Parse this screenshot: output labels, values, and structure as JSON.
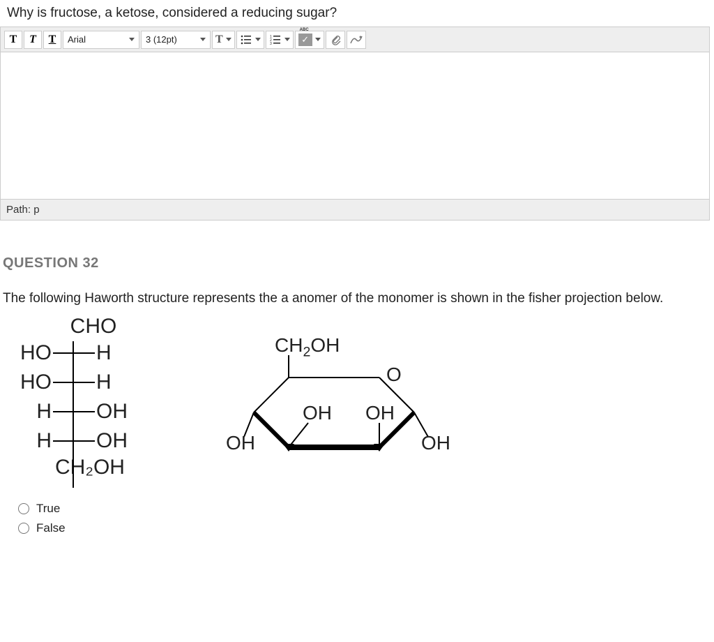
{
  "question1": {
    "prompt": "Why is fructose, a ketose, considered a reducing sugar?"
  },
  "toolbar": {
    "bold": "T",
    "italic": "T",
    "underline": "T",
    "font": "Arial",
    "size": "3 (12pt)",
    "textcolor": "T"
  },
  "path": {
    "label": "Path: p"
  },
  "question2": {
    "heading": "QUESTION 32",
    "text": "The following Haworth structure represents the a anomer of the monomer is shown in the fisher projection below."
  },
  "fischer": {
    "top": "CHO",
    "rows": [
      {
        "left": "HO",
        "right": "H"
      },
      {
        "left": "HO",
        "right": "H"
      },
      {
        "left": "H",
        "right": "OH"
      },
      {
        "left": "H",
        "right": "OH"
      }
    ],
    "bottom": "CH₂OH"
  },
  "haworth": {
    "labels": {
      "ch2oh": "CH₂OH",
      "o": "O",
      "oh": "OH"
    }
  },
  "options": {
    "true": "True",
    "false": "False"
  }
}
